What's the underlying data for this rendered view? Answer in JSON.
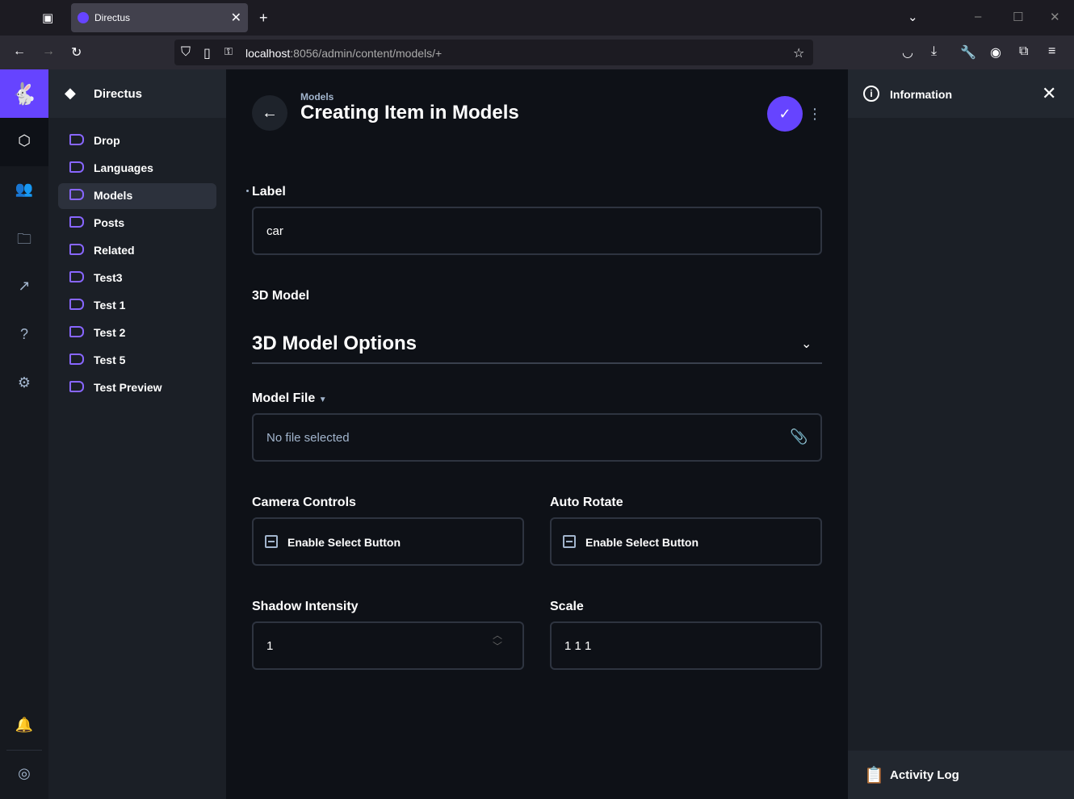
{
  "browser": {
    "tab_title": "Directus",
    "url_host": "localhost",
    "url_rest": ":8056/admin/content/models/+"
  },
  "sidebar": {
    "project_name": "Directus",
    "items": [
      {
        "label": "Drop"
      },
      {
        "label": "Languages"
      },
      {
        "label": "Models"
      },
      {
        "label": "Posts"
      },
      {
        "label": "Related"
      },
      {
        "label": "Test3"
      },
      {
        "label": "Test 1"
      },
      {
        "label": "Test 2"
      },
      {
        "label": "Test 5"
      },
      {
        "label": "Test Preview"
      }
    ]
  },
  "header": {
    "breadcrumb": "Models",
    "title": "Creating Item in Models"
  },
  "form": {
    "label_field": {
      "label": "Label",
      "value": "car"
    },
    "model_3d": {
      "label": "3D Model"
    },
    "options_divider": {
      "title": "3D Model Options"
    },
    "model_file": {
      "label": "Model File",
      "placeholder": "No file selected"
    },
    "camera_controls": {
      "label": "Camera Controls",
      "checkbox_label": "Enable Select Button"
    },
    "auto_rotate": {
      "label": "Auto Rotate",
      "checkbox_label": "Enable Select Button"
    },
    "shadow_intensity": {
      "label": "Shadow Intensity",
      "value": "1"
    },
    "scale": {
      "label": "Scale",
      "value": "1 1 1"
    }
  },
  "info_panel": {
    "title": "Information",
    "activity_log": "Activity Log"
  },
  "colors": {
    "accent": "#6644ff",
    "background": "#0e1117",
    "sidebar": "#1b1f26"
  }
}
